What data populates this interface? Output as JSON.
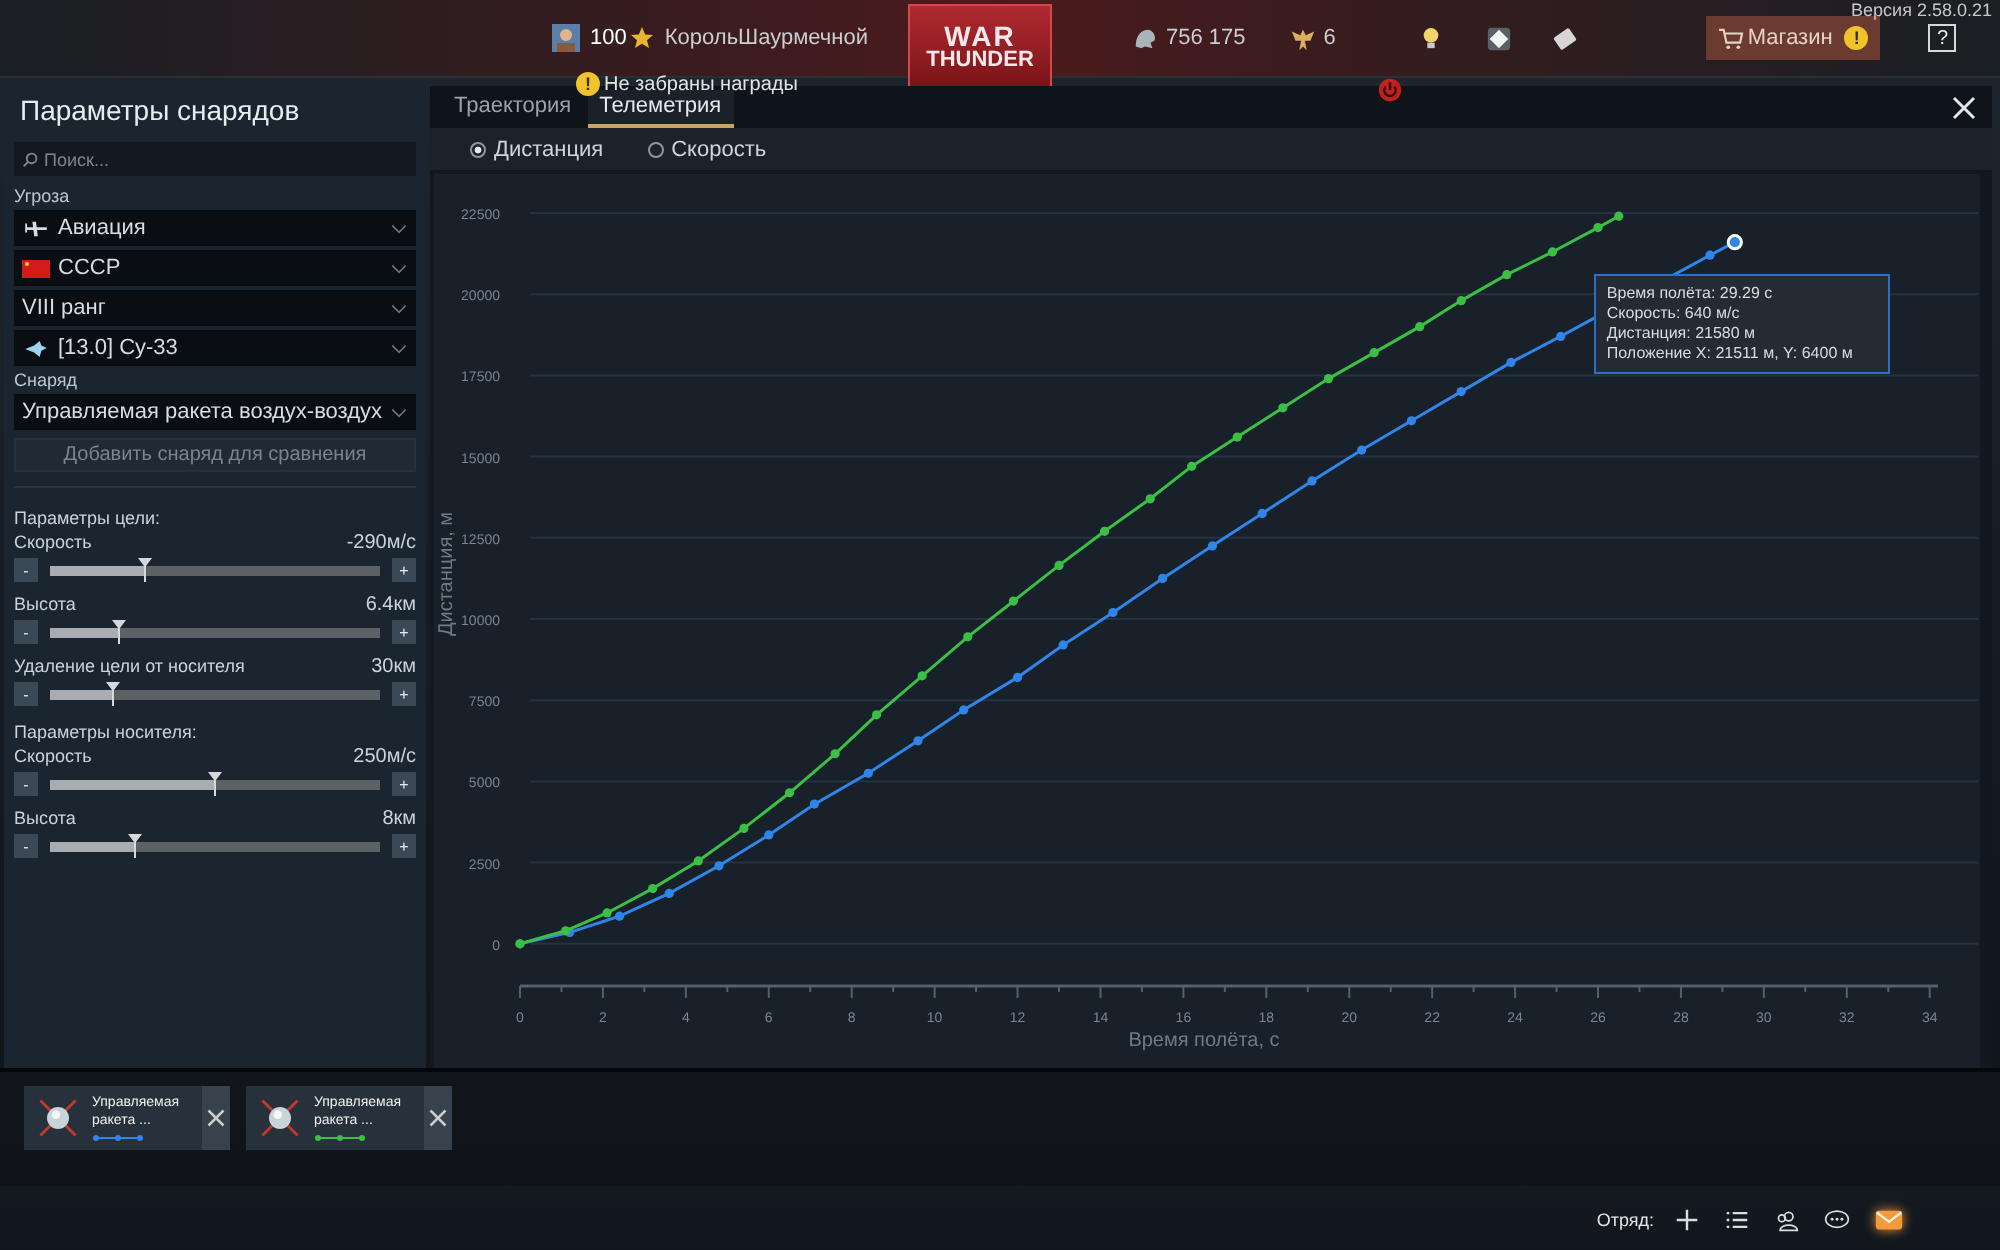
{
  "version": "Версия 2.58.0.21",
  "top_bar": {
    "level": "100",
    "player": "КорольШаурмечной",
    "notice_badge": "!",
    "notice": "Не забраны награды",
    "logo_top": "WAR",
    "logo_bottom": "THUNDER",
    "silver": "756 175",
    "gold": "6",
    "shop": "Магазин",
    "shop_badge": "!",
    "help": "?"
  },
  "sidebar": {
    "title": "Параметры снарядов",
    "search": {
      "placeholder": "Поиск..."
    },
    "threat_label": "Угроза",
    "threat": [
      {
        "kind": "plane",
        "value": "Авиация"
      },
      {
        "kind": "flag",
        "value": "СССР"
      },
      {
        "kind": "text",
        "value": "VIII ранг"
      },
      {
        "kind": "jet",
        "value": "[13.0] Су-33"
      }
    ],
    "shell_label": "Снаряд",
    "shell": "Управляемая ракета воздух-воздух",
    "add_button": {
      "label": "Добавить снаряд для сравнения",
      "disabled": true
    },
    "sliders": [
      {
        "section": "Параметры цели:",
        "label": "Скорость",
        "reading": "-290м/с",
        "level": 0.29
      },
      {
        "label": "Высота",
        "reading": "6.4км",
        "level": 0.21
      },
      {
        "label": "Удаление цели от носителя",
        "reading": "30км",
        "level": 0.19
      },
      {
        "section": "Параметры носителя:",
        "label": "Скорость",
        "reading": "250м/с",
        "level": 0.5
      },
      {
        "label": "Высота",
        "reading": "8км",
        "level": 0.26
      }
    ],
    "minus": "-",
    "plus": "+"
  },
  "tabs": [
    {
      "label": "Траектория",
      "selected": false
    },
    {
      "label": "Телеметрия",
      "selected": true
    }
  ],
  "modes": [
    {
      "label": "Дистанция",
      "selected": true
    },
    {
      "label": "Скорость",
      "selected": false
    }
  ],
  "chart_data": {
    "type": "line",
    "grid": true,
    "xlabel": "Время полёта, с",
    "ylabel": "Дистанция, м",
    "xlim": [
      0,
      34.2
    ],
    "ylim": [
      -1300,
      23700
    ],
    "xticks": [
      0,
      2,
      4,
      6,
      8,
      10,
      12,
      14,
      16,
      18,
      20,
      22,
      24,
      26,
      28,
      30,
      32,
      34
    ],
    "yticks": [
      0,
      2500,
      5000,
      7500,
      10000,
      12500,
      15000,
      17500,
      20000,
      22500
    ],
    "series": [
      {
        "color": "#2f86e8",
        "marker": "circle",
        "x": [
          0,
          1.2,
          2.4,
          3.6,
          4.8,
          6,
          7.1,
          8.4,
          9.6,
          10.7,
          12,
          13.1,
          14.3,
          15.5,
          16.7,
          17.9,
          19.1,
          20.3,
          21.5,
          22.7,
          23.9,
          25.1,
          28.7,
          29.3
        ],
        "values": [
          0,
          350,
          850,
          1550,
          2400,
          3350,
          4300,
          5250,
          6250,
          7200,
          8200,
          9200,
          10200,
          11250,
          12250,
          13250,
          14250,
          15200,
          16100,
          17000,
          17900,
          18700,
          21200,
          21600
        ]
      },
      {
        "color": "#3cbf45",
        "marker": "circle",
        "x": [
          0,
          1.1,
          2.1,
          3.2,
          4.3,
          5.4,
          6.5,
          7.6,
          8.6,
          9.7,
          10.8,
          11.9,
          13,
          14.1,
          15.2,
          16.2,
          17.3,
          18.4,
          19.5,
          20.6,
          21.7,
          22.7,
          23.8,
          24.9,
          26,
          26.5
        ],
        "values": [
          0,
          400,
          950,
          1700,
          2550,
          3550,
          4650,
          5850,
          7050,
          8250,
          9450,
          10550,
          11650,
          12700,
          13700,
          14700,
          15600,
          16500,
          17400,
          18200,
          19000,
          19800,
          20600,
          21300,
          22050,
          22400
        ]
      }
    ],
    "annotations": [
      {
        "text": [
          "Время полёта: 29.29 с",
          "Скорость: 640 м/с",
          "Дистанция: 21580 м",
          "Положение X: 21511 м, Y: 6400 м"
        ]
      }
    ]
  },
  "compare": [
    {
      "label": "Управляемая ракета ...",
      "color": "#2f86e8"
    },
    {
      "label": "Управляемая ракета ...",
      "color": "#3cbf45"
    }
  ],
  "bottom_bar": {
    "squad": "Отряд:"
  }
}
